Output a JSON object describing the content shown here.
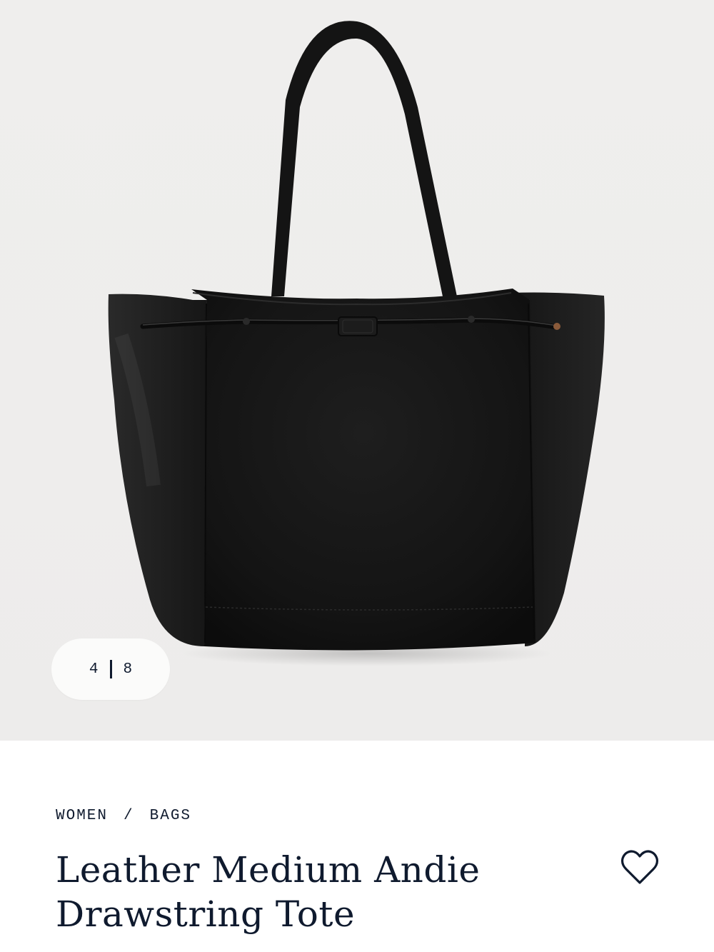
{
  "gallery": {
    "current_image": "4",
    "total_images": "8",
    "image_alt": "Leather Medium Andie Drawstring Tote"
  },
  "breadcrumb": {
    "items": [
      "WOMEN",
      "BAGS"
    ],
    "separator": "/"
  },
  "product": {
    "title": "Leather Medium Andie Drawstring Tote"
  },
  "icons": {
    "wishlist": "heart-icon"
  },
  "colors": {
    "brand_navy": "#0f1a2e",
    "gallery_bg": "#eeedec",
    "bag_leather": "#1a1a1a"
  }
}
